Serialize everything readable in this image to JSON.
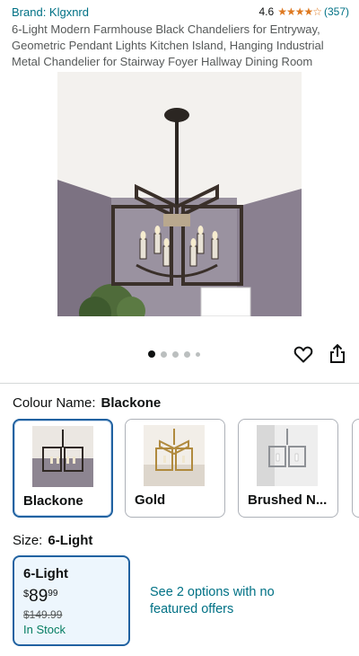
{
  "product": {
    "brand": "Brand: Klgxnrd",
    "rating": "4.6",
    "stars": "★★★★☆",
    "review_count": "(357)",
    "title": "6-Light Modern Farmhouse Black Chandeliers for Entryway, Geometric Pendant Lights Kitchen Island, Hanging Industrial Metal Chandelier for Stairway Foyer Hallway Dining Room"
  },
  "gallery": {
    "image_count": 5,
    "active_index": 0
  },
  "colour": {
    "label": "Colour Name:",
    "selected": "Blackone",
    "options": [
      {
        "label": "Blackone",
        "selected": true
      },
      {
        "label": "Gold",
        "selected": false
      },
      {
        "label": "Brushed N...",
        "selected": false
      }
    ]
  },
  "size": {
    "label": "Size:",
    "selected": "6-Light",
    "card": {
      "name": "6-Light",
      "currency": "$",
      "price_whole": "89",
      "price_fraction": "99",
      "list_price": "$149.99",
      "stock": "In Stock"
    },
    "other_options": "See 2 options with no featured offers"
  },
  "colors": {
    "link": "#007185",
    "stars": "#de7921",
    "selected_border": "#2162a1",
    "in_stock": "#067d62"
  }
}
